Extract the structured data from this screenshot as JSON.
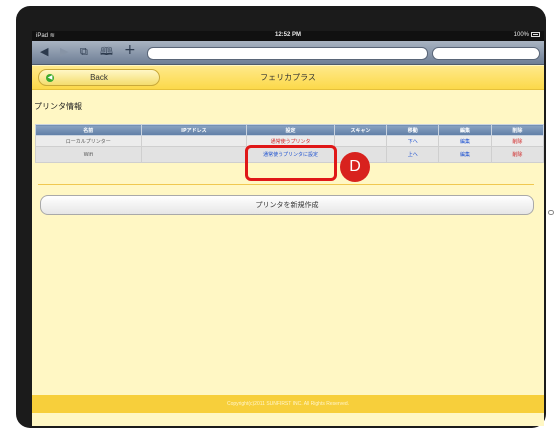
{
  "status_bar": {
    "device": "iPad",
    "wifi_icon": "wifi-icon",
    "time": "12:52 PM",
    "battery": "100%"
  },
  "browser": {
    "back_glyph": "◀",
    "forward_glyph": "▶",
    "pages_glyph": "⧉",
    "bookmarks_glyph": "🕮",
    "add_glyph": "+"
  },
  "header": {
    "back_label": "Back",
    "back_arrow_glyph": "◀",
    "title": "フェリカプラス"
  },
  "section_title": "プリンタ情報",
  "table": {
    "columns": [
      "名前",
      "IPアドレス",
      "設定",
      "スキャン",
      "移動",
      "編集",
      "削除"
    ],
    "rows": [
      {
        "name": "ローカルプリンター",
        "ip": "",
        "setting": "通常使うプリンタ",
        "scan": "",
        "move": "下へ",
        "edit": "編集",
        "delete": "削除"
      },
      {
        "name": "Wifi",
        "ip": "",
        "setting": "通常使うプリンタに設定",
        "scan": "",
        "move": "上へ",
        "edit": "編集",
        "delete": "削除"
      }
    ]
  },
  "callout_badge": "D",
  "new_printer_button": "プリンタを新規作成",
  "footer": "Copyright(c)2011 SUNFIRST INC. All Rights Reserved.",
  "colors": {
    "header": "#fcd94a",
    "table_header": "#6b88af",
    "callout": "#d8221e",
    "link": "#1a4fd0"
  }
}
